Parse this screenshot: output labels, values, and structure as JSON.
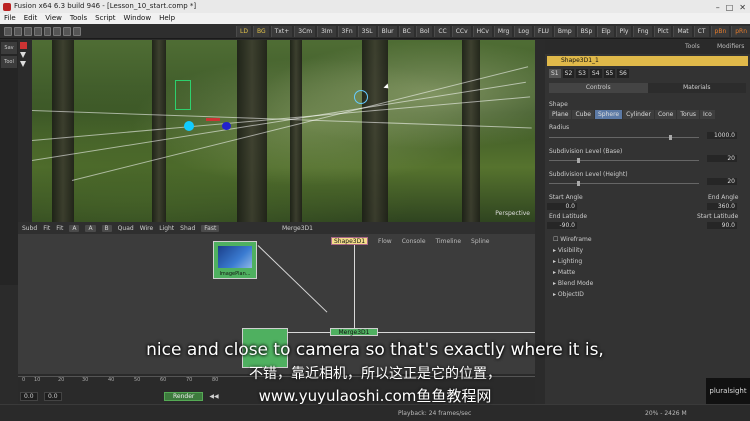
{
  "window": {
    "title": "Fusion x64 6.3 build 946 - [Lesson_10_start.comp *]",
    "controls": [
      "–",
      "□",
      "✕"
    ]
  },
  "menu": [
    "File",
    "Edit",
    "View",
    "Tools",
    "Script",
    "Window",
    "Help"
  ],
  "toolbar": {
    "buttons": [
      "LD",
      "BG",
      "Txt+",
      "3Cm",
      "3Im",
      "3Fn",
      "3SL",
      "Blur",
      "BC",
      "Bol",
      "CC",
      "CCv",
      "HCv",
      "Mrg",
      "Log",
      "FLU",
      "Bmp",
      "BSp",
      "Elp",
      "Ply",
      "Fng",
      "Plct",
      "Mat",
      "CT",
      "pBn",
      "pRn"
    ]
  },
  "sidebar": {
    "tabs": [
      "Sav",
      "Tool"
    ]
  },
  "viewport": {
    "badge": "Perspective",
    "toolbar": [
      "Subd",
      "Fit",
      "Fit",
      "A",
      "A",
      "B",
      "Quad",
      "Wire",
      "Light",
      "Shad",
      "Fast"
    ],
    "title": "Merge3D1"
  },
  "flow": {
    "tabs": [
      "Flow",
      "Console",
      "Timeline",
      "Spline"
    ],
    "nodes": {
      "imageplane": "ImagePlan...",
      "shape3d": "Shape3D1",
      "merge3d": "Merge3D1"
    }
  },
  "timeline": {
    "ticks": [
      "0",
      "10",
      "20",
      "30",
      "40",
      "50",
      "60",
      "70",
      "80"
    ],
    "start": "0.0",
    "end": "0.0",
    "render": "Render"
  },
  "status": {
    "playback": "Playback: 24 frames/sec",
    "mem": "20% - 2426 M"
  },
  "panel": {
    "tabs": [
      "Tools",
      "Modifiers"
    ],
    "tool_name": "Shape3D1_1",
    "stabs": [
      "S1",
      "S2",
      "S3",
      "S4",
      "S5",
      "S6"
    ],
    "ctrl_tabs": [
      "Controls",
      "Materials"
    ],
    "shape_label": "Shape",
    "shapes": [
      "Plane",
      "Cube",
      "Sphere",
      "Cylinder",
      "Cone",
      "Torus",
      "Ico"
    ],
    "radius_label": "Radius",
    "radius": "1000.0",
    "subdiv_base_label": "Subdivision Level (Base)",
    "subdiv_base": "20",
    "subdiv_height_label": "Subdivision Level (Height)",
    "subdiv_height": "20",
    "start_angle_label": "Start Angle",
    "start_angle": "0.0",
    "end_angle_label": "End Angle",
    "end_angle": "360.0",
    "end_lat_label": "End Latitude",
    "end_lat": "-90.0",
    "start_lat_label": "Start Latitude",
    "start_lat": "90.0",
    "wireframe": "Wireframe",
    "sections": [
      "Visibility",
      "Lighting",
      "Matte",
      "Blend Mode",
      "ObjectID"
    ]
  },
  "subtitles": {
    "en": "nice and close to camera so that's exactly where it is,",
    "cn": "不错，靠近相机，所以这正是它的位置，",
    "web": "www.yuyulaoshi.com鱼鱼教程网"
  },
  "logo": "pluralsight"
}
